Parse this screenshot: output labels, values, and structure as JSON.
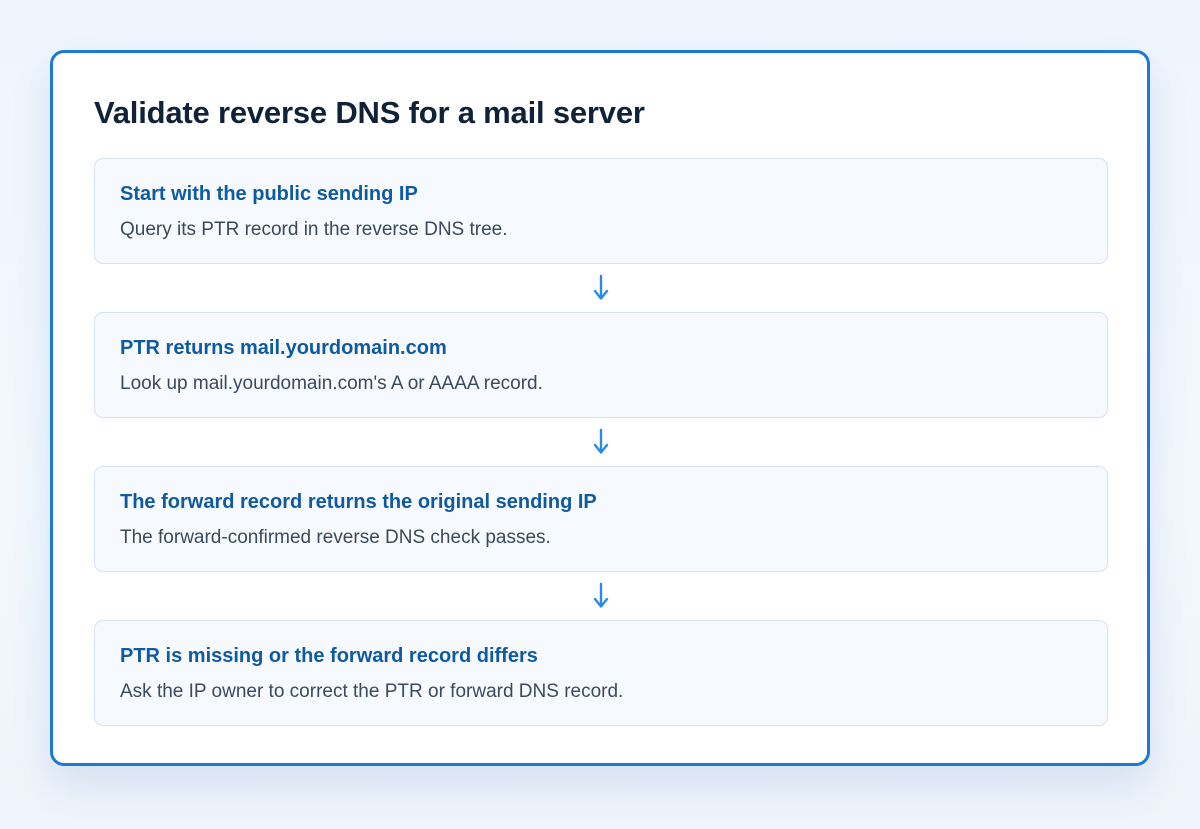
{
  "diagram": {
    "title": "Validate reverse DNS for a mail server",
    "steps": [
      {
        "title": "Start with the public sending IP",
        "description": "Query its PTR record in the reverse DNS tree."
      },
      {
        "title": "PTR returns mail.yourdomain.com",
        "description": "Look up mail.yourdomain.com's A or AAAA record."
      },
      {
        "title": "The forward record returns the original sending IP",
        "description": "The forward-confirmed reverse DNS check passes."
      },
      {
        "title": "PTR is missing or the forward record differs",
        "description": "Ask the IP owner to correct the PTR or forward DNS record."
      }
    ],
    "connector_icon": "arrow-down-icon",
    "colors": {
      "accent": "#1f78d1",
      "step_title": "#0f5aa0",
      "arrow": "#2b8ae6",
      "heading": "#0f2238"
    }
  }
}
